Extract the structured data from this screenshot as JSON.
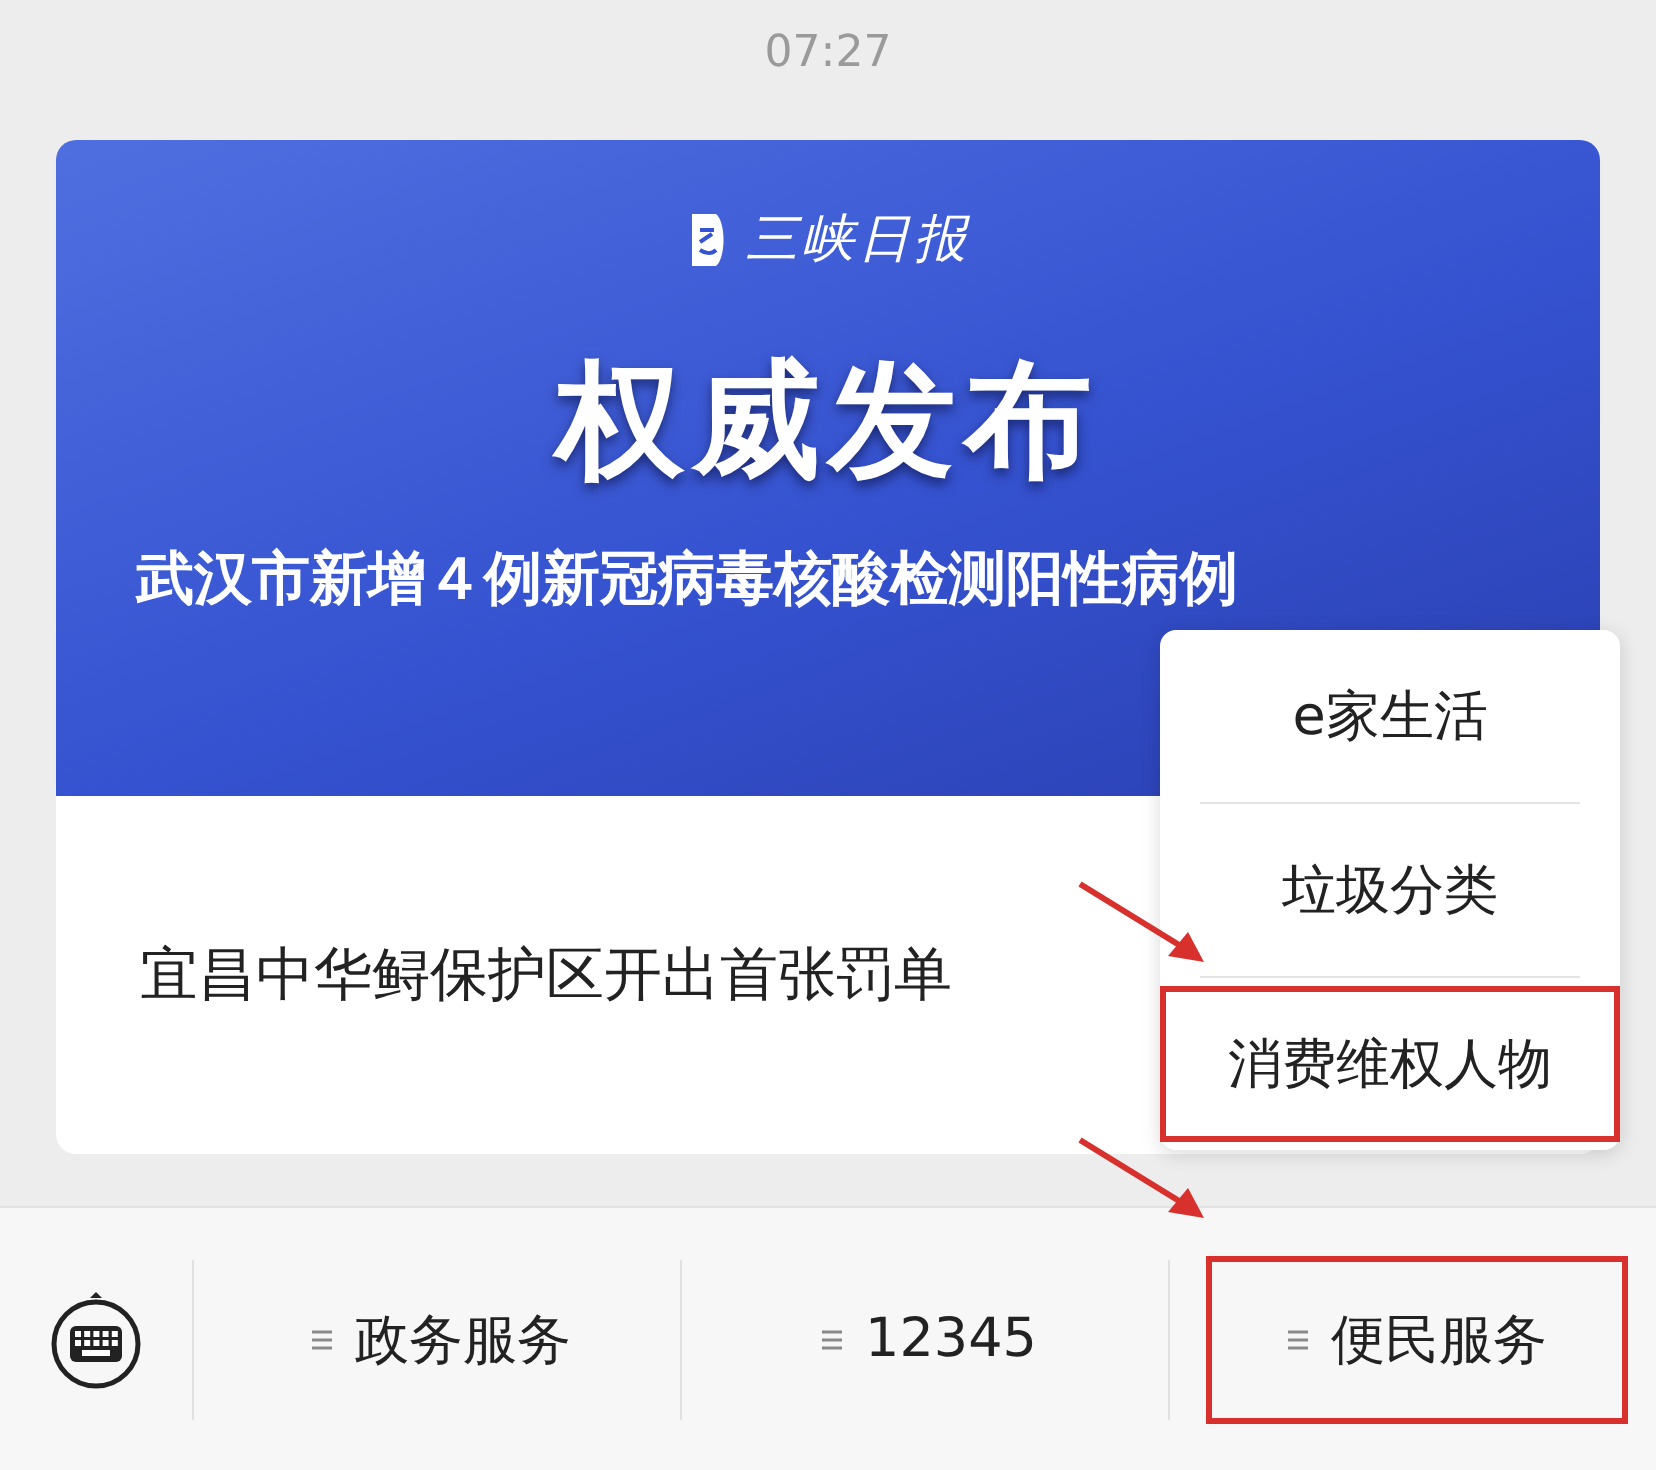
{
  "time": "07:27",
  "banner": {
    "logo": "三峡日报",
    "headline": "权威发布",
    "title": "武汉市新增４例新冠病毒核酸检测阳性病例"
  },
  "article_title": "宜昌中华鲟保护区开出首张罚单",
  "popup_menu": [
    {
      "label": "e家生活",
      "highlighted": false
    },
    {
      "label": "垃圾分类",
      "highlighted": false
    },
    {
      "label": "消费维权人物",
      "highlighted": true
    }
  ],
  "bottom_menu": [
    {
      "label": "政务服务",
      "highlighted": false
    },
    {
      "label": "12345",
      "highlighted": false
    },
    {
      "label": "便民服务",
      "highlighted": true
    }
  ]
}
